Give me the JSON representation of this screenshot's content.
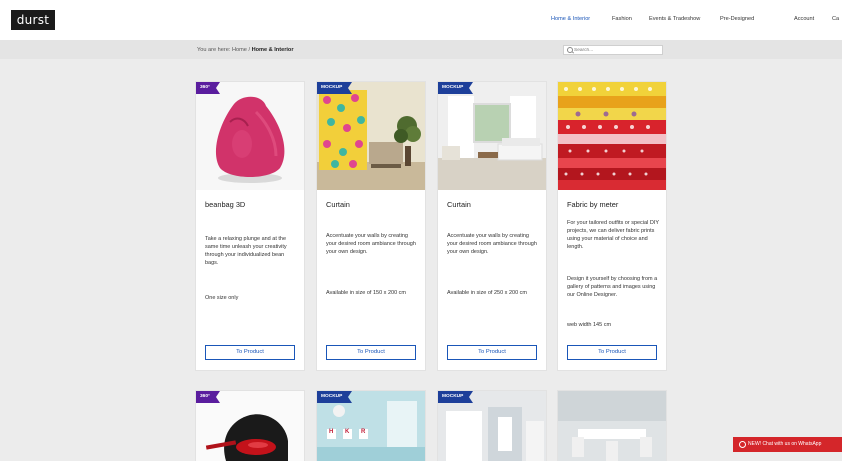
{
  "brand": {
    "logo_text": "durst"
  },
  "nav": {
    "items": [
      "Home & Interior",
      "Fashion",
      "Events & Tradeshow",
      "Pre-Designed",
      "Account",
      "Ca"
    ],
    "active": "Home & Interior"
  },
  "breadcrumb": {
    "prefix": "You are here:",
    "home": "Home",
    "separator": "/",
    "current": "Home & Interior"
  },
  "search": {
    "placeholder": "Search..."
  },
  "products": [
    {
      "badge": "360°",
      "title": "beanbag 3D",
      "description": "Take a relaxing plunge and at the same time unleash your creativity through your individualized bean bags.",
      "extra": "One size only",
      "button": "To Product"
    },
    {
      "badge": "MOCKUP",
      "title": "Curtain",
      "description": "Accentuate your walls by creating your desired room ambiance through your own design.",
      "extra": "Available in size of 150 x 200 cm",
      "button": "To Product"
    },
    {
      "badge": "MOCKUP",
      "title": "Curtain",
      "description": "Accentuate your walls by creating your desired room ambiance through your own design.",
      "extra": "Available in size of 250 x 200 cm",
      "button": "To Product"
    },
    {
      "badge": "",
      "title": "Fabric by meter",
      "description": "For your tailored outfits or special DIY projects, we can deliver fabric prints using your material of choice and length.",
      "extra": "Design it yourself by choosing from a gallery of patterns and images using our Online Designer.",
      "extra2": "web width 145 cm",
      "button": "To Product"
    }
  ],
  "row2": [
    {
      "badge": "360°"
    },
    {
      "badge": "MOCKUP",
      "letters": [
        "H",
        "K",
        "R"
      ]
    },
    {
      "badge": "MOCKUP"
    },
    {
      "badge": ""
    }
  ],
  "whatsapp": {
    "label": "NEW! Chat with us on WhatsApp"
  },
  "colors": {
    "accent": "#1a56b8",
    "badge_mockup": "#1d3f9a",
    "badge_360": "#5a1d9e",
    "whatsapp": "#d4262a"
  }
}
